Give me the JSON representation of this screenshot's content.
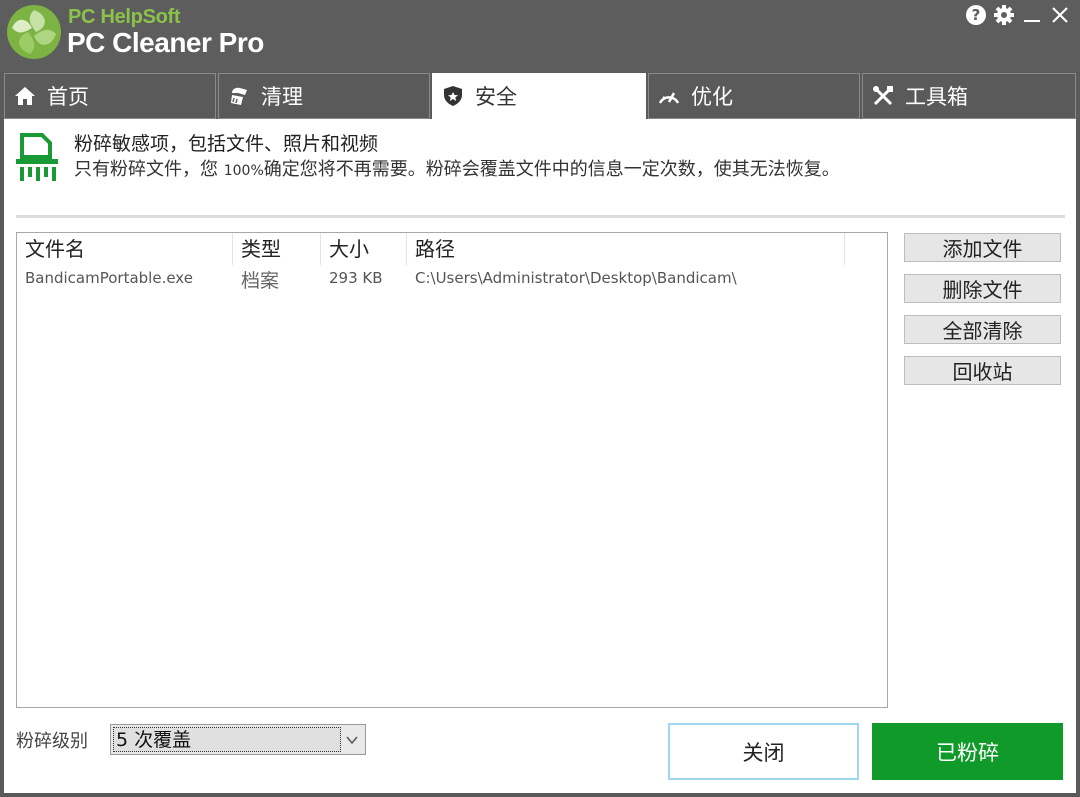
{
  "app": {
    "brand_small": "PC HelpSoft",
    "brand_big": "PC Cleaner Pro"
  },
  "tabs": [
    {
      "label": "首页",
      "icon": "home-icon"
    },
    {
      "label": "清理",
      "icon": "broom-icon"
    },
    {
      "label": "安全",
      "icon": "shield-icon",
      "active": true
    },
    {
      "label": "优化",
      "icon": "speedometer-icon"
    },
    {
      "label": "工具箱",
      "icon": "tools-icon"
    }
  ],
  "header": {
    "title": "粉碎敏感项，包括文件、照片和视频",
    "desc_pre": "只有粉碎文件，您 ",
    "desc_pct": "100%",
    "desc_post": "确定您将不再需要。粉碎会覆盖文件中的信息一定次数，使其无法恢复。"
  },
  "table": {
    "columns": [
      "文件名",
      "类型",
      "大小",
      "路径"
    ],
    "rows": [
      {
        "name": "BandicamPortable.exe",
        "type": "档案",
        "size": "293 KB",
        "path": "C:\\Users\\Administrator\\Desktop\\Bandicam\\"
      }
    ]
  },
  "side_buttons": {
    "add": "添加文件",
    "delete": "删除文件",
    "clear_all": "全部清除",
    "recycle": "回收站"
  },
  "shred_level": {
    "label": "粉碎级别",
    "selected": "5 次覆盖"
  },
  "footer": {
    "close": "关闭",
    "shred": "已粉碎"
  },
  "colors": {
    "accent_green": "#0f9a2a",
    "brand_green": "#8bc34a",
    "titlebar": "#5d5d5d"
  }
}
